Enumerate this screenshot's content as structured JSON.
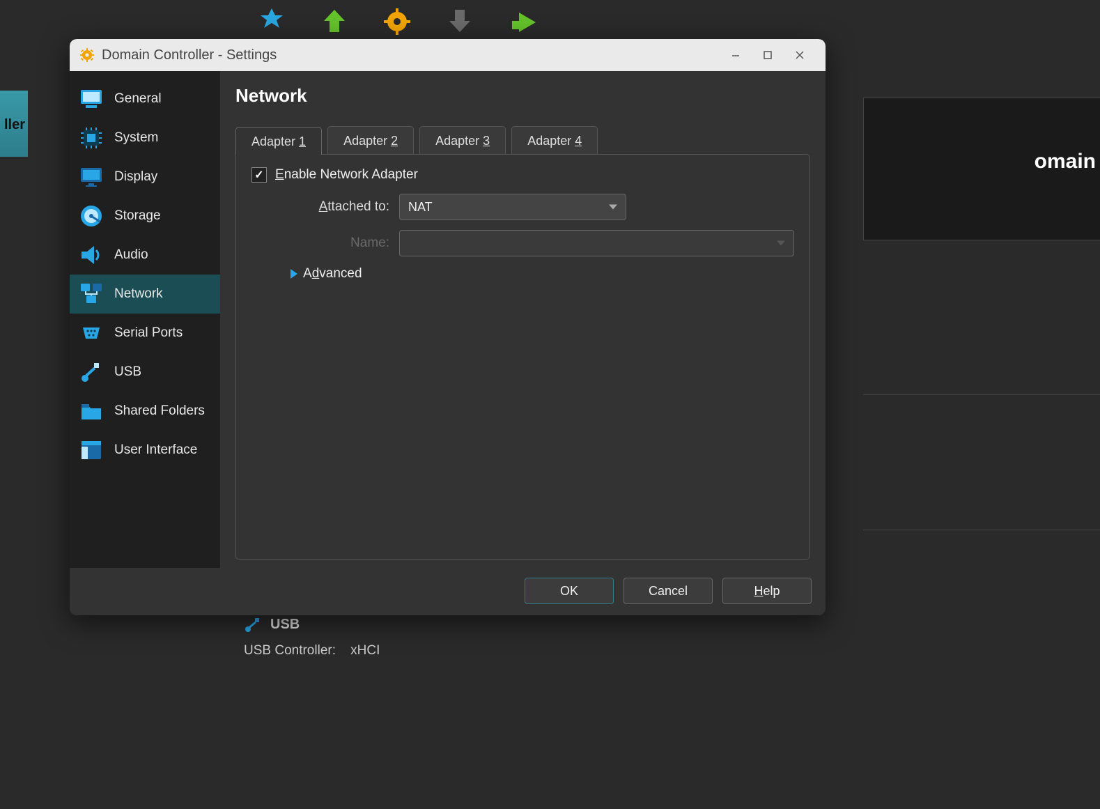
{
  "bg": {
    "vm_tab_fragment": "ller",
    "right_fragment": "omain",
    "usb_heading": "USB",
    "usb_controller_label": "USB Controller:",
    "usb_controller_value": "xHCI"
  },
  "window": {
    "title": "Domain Controller - Settings"
  },
  "sidebar": {
    "items": [
      {
        "label": "General"
      },
      {
        "label": "System"
      },
      {
        "label": "Display"
      },
      {
        "label": "Storage"
      },
      {
        "label": "Audio"
      },
      {
        "label": "Network"
      },
      {
        "label": "Serial Ports"
      },
      {
        "label": "USB"
      },
      {
        "label": "Shared Folders"
      },
      {
        "label": "User Interface"
      }
    ],
    "selected_index": 5
  },
  "page": {
    "title": "Network",
    "tabs": [
      {
        "prefix": "Adapter ",
        "mnemonic": "1"
      },
      {
        "prefix": "Adapter ",
        "mnemonic": "2"
      },
      {
        "prefix": "Adapter ",
        "mnemonic": "3"
      },
      {
        "prefix": "Adapter ",
        "mnemonic": "4"
      }
    ],
    "active_tab": 0,
    "enable_label_prefix": "E",
    "enable_label_rest": "nable Network Adapter",
    "enable_checked": true,
    "attached_label_prefix": "A",
    "attached_label_rest": "ttached to:",
    "attached_value": "NAT",
    "name_label": "Name:",
    "name_value": "",
    "advanced_prefix": "A",
    "advanced_mnemonic": "d",
    "advanced_rest": "vanced"
  },
  "buttons": {
    "ok": "OK",
    "cancel": "Cancel",
    "help_mnemonic": "H",
    "help_rest": "elp"
  }
}
